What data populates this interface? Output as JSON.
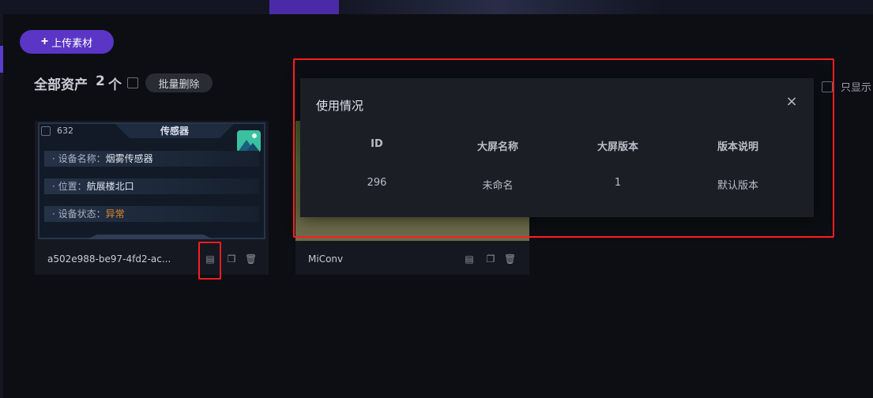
{
  "toolbar": {
    "upload_label": "上传素材"
  },
  "assets": {
    "title": "全部资产",
    "count": "2",
    "unit": "个",
    "batch_delete_label": "批量删除",
    "only_show_label": "只显示"
  },
  "cards": [
    {
      "filename": "a502e988-be97-4fd2-ac...",
      "preview": {
        "number": "632",
        "header": "传感器",
        "rows": [
          {
            "label": "设备名称：",
            "value": "烟雾传感器"
          },
          {
            "label": "位置：",
            "value": "航展楼北口"
          },
          {
            "label": "设备状态：",
            "value": "异常"
          }
        ]
      }
    },
    {
      "filename": "MiConv"
    }
  ],
  "modal": {
    "title": "使用情况",
    "close_glyph": "×",
    "columns": [
      "ID",
      "大屏名称",
      "大屏版本",
      "版本说明"
    ],
    "rows": [
      [
        "296",
        "未命名",
        "1",
        "默认版本"
      ]
    ]
  },
  "colors": {
    "accent": "#5a35c6",
    "highlight": "#ff1d1d",
    "warning": "#e08a2e"
  },
  "icons": [
    "plus-icon",
    "document-icon",
    "copy-icon",
    "trash-icon",
    "image-icon",
    "close-icon"
  ]
}
